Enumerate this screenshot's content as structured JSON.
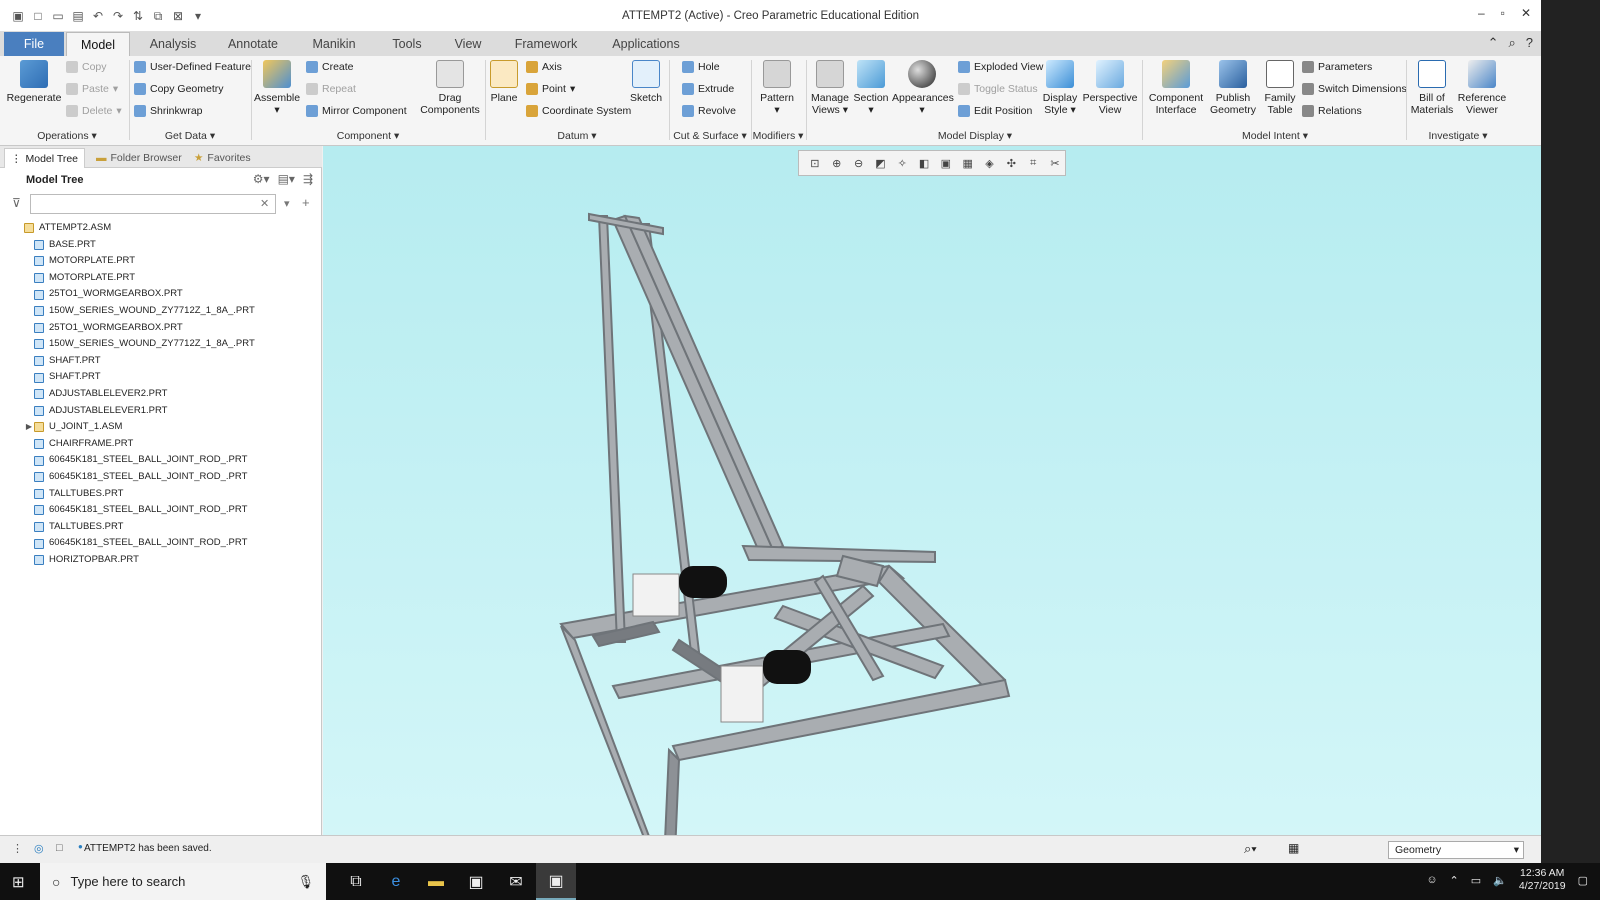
{
  "window": {
    "title": "ATTEMPT2 (Active) - Creo Parametric Educational Edition"
  },
  "tabs": [
    {
      "label": "File"
    },
    {
      "label": "Model"
    },
    {
      "label": "Analysis"
    },
    {
      "label": "Annotate"
    },
    {
      "label": "Manikin"
    },
    {
      "label": "Tools"
    },
    {
      "label": "View"
    },
    {
      "label": "Framework"
    },
    {
      "label": "Applications"
    }
  ],
  "ribbon": {
    "regenerate": "Regenerate",
    "copy": "Copy",
    "paste": "Paste",
    "delete": "Delete",
    "udf": "User-Defined Feature",
    "copy_geometry": "Copy Geometry",
    "shrinkwrap": "Shrinkwrap",
    "assemble": "Assemble",
    "create": "Create",
    "repeat": "Repeat",
    "mirror_component": "Mirror Component",
    "drag_components": "Drag Components",
    "plane": "Plane",
    "axis": "Axis",
    "point": "Point",
    "coordinate_system": "Coordinate System",
    "sketch": "Sketch",
    "hole": "Hole",
    "extrude": "Extrude",
    "revolve": "Revolve",
    "pattern": "Pattern",
    "manage_views": "Manage Views",
    "section": "Section",
    "appearances": "Appearances",
    "exploded_view": "Exploded View",
    "toggle_status": "Toggle Status",
    "edit_position": "Edit Position",
    "display_style": "Display Style",
    "perspective_view": "Perspective View",
    "component_interface": "Component Interface",
    "publish_geometry": "Publish Geometry",
    "family_table": "Family Table",
    "parameters": "Parameters",
    "switch_dimensions": "Switch Dimensions",
    "relations": "Relations",
    "bill_of_materials": "Bill of Materials",
    "reference_viewer": "Reference Viewer",
    "groups": {
      "operations": "Operations",
      "get_data": "Get Data",
      "component": "Component",
      "datum": "Datum",
      "cut_surface": "Cut & Surface",
      "modifiers": "Modifiers",
      "model_display": "Model Display",
      "model_intent": "Model Intent",
      "investigate": "Investigate"
    }
  },
  "panel": {
    "tabs": [
      "Model Tree",
      "Folder Browser",
      "Favorites"
    ],
    "header": "Model Tree",
    "filter_placeholder": "",
    "tree": [
      {
        "label": "ATTEMPT2.ASM",
        "type": "asm"
      },
      {
        "label": "BASE.PRT",
        "type": "prt"
      },
      {
        "label": "MOTORPLATE.PRT",
        "type": "prt"
      },
      {
        "label": "MOTORPLATE.PRT",
        "type": "prt"
      },
      {
        "label": "25TO1_WORMGEARBOX.PRT",
        "type": "prt"
      },
      {
        "label": "150W_SERIES_WOUND_ZY7712Z_1_8A_.PRT",
        "type": "prt"
      },
      {
        "label": "25TO1_WORMGEARBOX.PRT",
        "type": "prt"
      },
      {
        "label": "150W_SERIES_WOUND_ZY7712Z_1_8A_.PRT",
        "type": "prt"
      },
      {
        "label": "SHAFT.PRT",
        "type": "prt"
      },
      {
        "label": "SHAFT.PRT",
        "type": "prt"
      },
      {
        "label": "ADJUSTABLELEVER2.PRT",
        "type": "prt"
      },
      {
        "label": "ADJUSTABLELEVER1.PRT",
        "type": "prt"
      },
      {
        "label": "U_JOINT_1.ASM",
        "type": "asm"
      },
      {
        "label": "CHAIRFRAME.PRT",
        "type": "prt"
      },
      {
        "label": "60645K181_STEEL_BALL_JOINT_ROD_.PRT",
        "type": "prt"
      },
      {
        "label": "60645K181_STEEL_BALL_JOINT_ROD_.PRT",
        "type": "prt"
      },
      {
        "label": "TALLTUBES.PRT",
        "type": "prt"
      },
      {
        "label": "60645K181_STEEL_BALL_JOINT_ROD_.PRT",
        "type": "prt"
      },
      {
        "label": "TALLTUBES.PRT",
        "type": "prt"
      },
      {
        "label": "60645K181_STEEL_BALL_JOINT_ROD_.PRT",
        "type": "prt"
      },
      {
        "label": "HORIZTOPBAR.PRT",
        "type": "prt"
      }
    ]
  },
  "status": {
    "message": "ATTEMPT2 has been saved.",
    "filter": "Geometry"
  },
  "taskbar": {
    "search": "Type here to search",
    "time": "12:36 AM",
    "date": "4/27/2019"
  }
}
